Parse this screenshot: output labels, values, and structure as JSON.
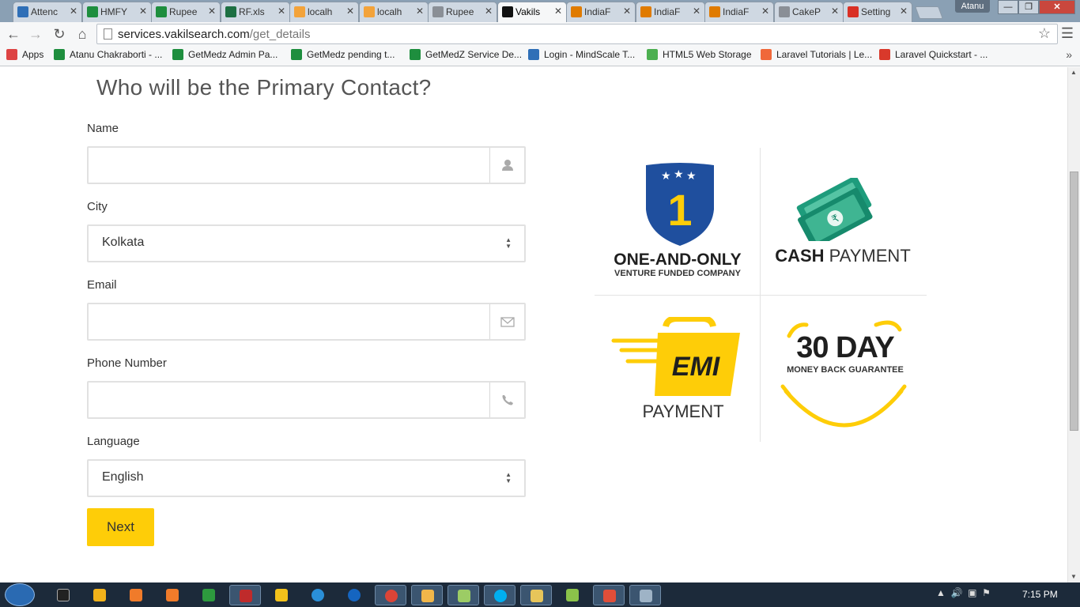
{
  "browser": {
    "tabs": [
      {
        "title": "Attenc",
        "icon": "hr-icon",
        "color": "#2f6fb7"
      },
      {
        "title": "HMFY",
        "icon": "sheets-icon",
        "color": "#1e8e3e"
      },
      {
        "title": "Rupee",
        "icon": "sheets-icon",
        "color": "#1e8e3e"
      },
      {
        "title": "RF.xls",
        "icon": "excel-icon",
        "color": "#1d6f42"
      },
      {
        "title": "localh",
        "icon": "pma-icon",
        "color": "#f3a33a"
      },
      {
        "title": "localh",
        "icon": "pma-icon",
        "color": "#f3a33a"
      },
      {
        "title": "Rupee",
        "icon": "page-icon",
        "color": "#8a8f96"
      },
      {
        "title": "Vakils",
        "icon": "vs-icon",
        "color": "#111111"
      },
      {
        "title": "IndiaF",
        "icon": "india-icon",
        "color": "#e07b00"
      },
      {
        "title": "IndiaF",
        "icon": "india-icon",
        "color": "#e07b00"
      },
      {
        "title": "IndiaF",
        "icon": "india-icon",
        "color": "#e07b00"
      },
      {
        "title": "CakeP",
        "icon": "page-icon",
        "color": "#8a8f96"
      },
      {
        "title": "Setting",
        "icon": "gmail-icon",
        "color": "#d93025"
      }
    ],
    "active_tab_index": 7,
    "user_name": "Atanu",
    "url_host": "services.vakilsearch.com",
    "url_path": "/get_details",
    "bookmarks": [
      {
        "label": "Apps",
        "icon": "apps-icon",
        "color": "#d44"
      },
      {
        "label": "Atanu Chakraborti - ...",
        "icon": "sheets-icon",
        "color": "#1e8e3e"
      },
      {
        "label": "GetMedz Admin Pa...",
        "icon": "sheets-icon",
        "color": "#1e8e3e"
      },
      {
        "label": "GetMedz pending t...",
        "icon": "sheets-icon",
        "color": "#1e8e3e"
      },
      {
        "label": "GetMedZ Service De...",
        "icon": "sheets-icon",
        "color": "#1e8e3e"
      },
      {
        "label": "Login - MindScale T...",
        "icon": "hr-icon",
        "color": "#2f6fb7"
      },
      {
        "label": "HTML5 Web Storage",
        "icon": "w3-icon",
        "color": "#4caf50"
      },
      {
        "label": "Laravel Tutorials | Le...",
        "icon": "laravel-icon",
        "color": "#f0683a"
      },
      {
        "label": "Laravel Quickstart - ...",
        "icon": "laravel-icon",
        "color": "#d9392b"
      }
    ]
  },
  "form": {
    "title": "Who will be the Primary Contact?",
    "name_label": "Name",
    "name_value": "",
    "city_label": "City",
    "city_value": "Kolkata",
    "email_label": "Email",
    "email_value": "",
    "phone_label": "Phone Number",
    "phone_value": "",
    "language_label": "Language",
    "language_value": "English",
    "next_label": "Next"
  },
  "badges": {
    "one": {
      "big": "ONE-AND-ONLY",
      "small": "VENTURE FUNDED COMPANY",
      "numeral": "1"
    },
    "cash": {
      "bold": "CASH",
      "rest": " PAYMENT"
    },
    "emi": {
      "logo": "EMI",
      "caption": "PAYMENT"
    },
    "guarantee": {
      "big": "30 DAY",
      "small": "MONEY BACK GUARANTEE"
    }
  },
  "taskbar": {
    "clock": "7:15 PM"
  },
  "colors": {
    "accent_yellow": "#fecd08",
    "badge_blue": "#1f4f9e",
    "cash_green": "#1e9c7c"
  }
}
